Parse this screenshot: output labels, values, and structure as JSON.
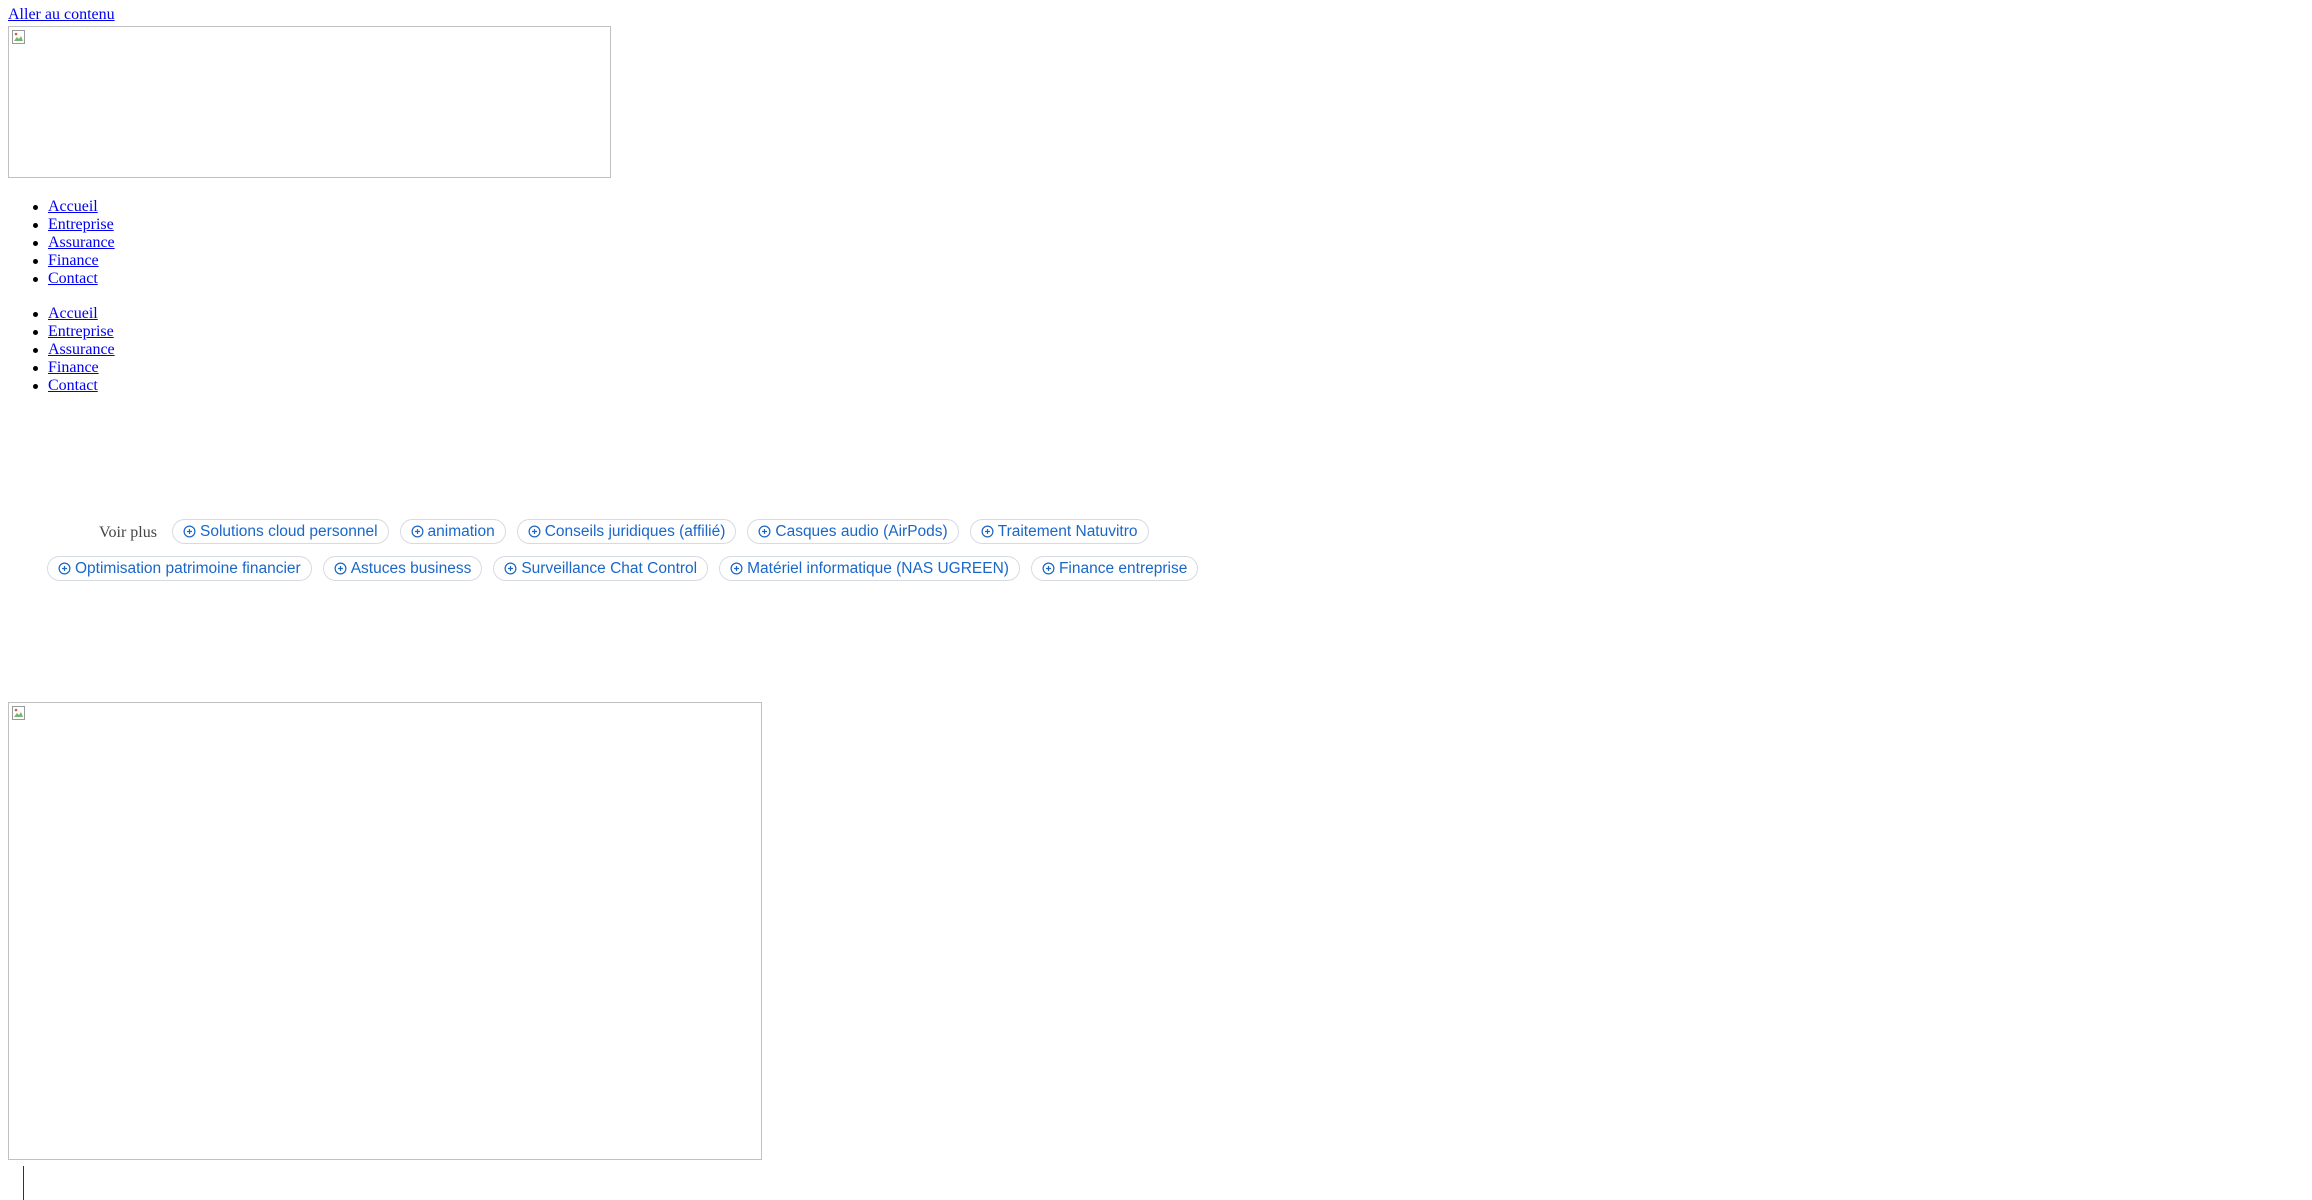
{
  "skip_link": "Aller au contenu",
  "logo": {
    "icon": "broken-image-icon"
  },
  "nav_primary": {
    "items": [
      {
        "label": "Accueil"
      },
      {
        "label": "Entreprise"
      },
      {
        "label": "Assurance"
      },
      {
        "label": "Finance"
      },
      {
        "label": "Contact"
      }
    ]
  },
  "nav_secondary": {
    "items": [
      {
        "label": "Accueil"
      },
      {
        "label": "Entreprise"
      },
      {
        "label": "Assurance"
      },
      {
        "label": "Finance"
      },
      {
        "label": "Contact"
      }
    ]
  },
  "tags": {
    "voir_plus": "Voir plus",
    "chip_icon": "plus-circle-icon",
    "accent_color": "#1a67c9",
    "row1": [
      {
        "label": "Solutions cloud personnel"
      },
      {
        "label": "animation"
      },
      {
        "label": "Conseils juridiques (affilié)"
      },
      {
        "label": "Casques audio (AirPods)"
      },
      {
        "label": "Traitement Natuvitro"
      }
    ],
    "row2": [
      {
        "label": "Optimisation patrimoine financier"
      },
      {
        "label": "Astuces business"
      },
      {
        "label": "Surveillance Chat Control"
      },
      {
        "label": "Matériel informatique (NAS UGREEN)"
      },
      {
        "label": "Finance entreprise"
      }
    ]
  },
  "hero_image": {
    "icon": "broken-image-icon"
  }
}
